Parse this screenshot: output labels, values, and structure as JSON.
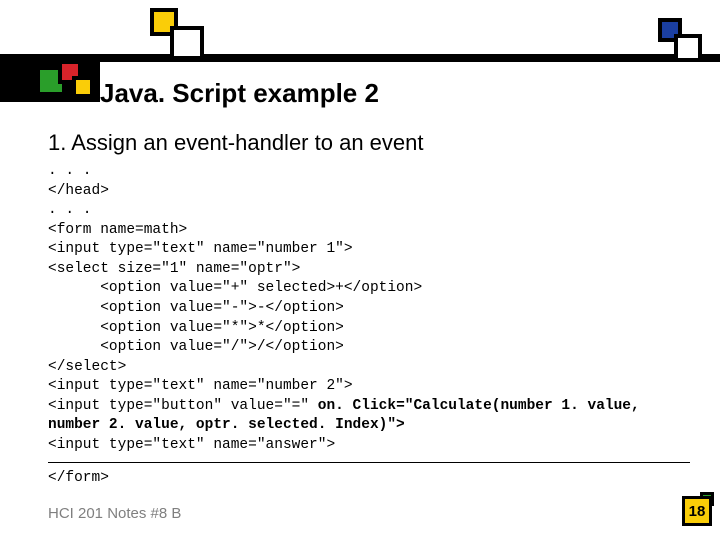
{
  "title": "Java. Script example 2",
  "subtitle": "1. Assign an event-handler to an event",
  "code": {
    "pre": ". . .\n</head>\n. . .\n<form name=math>\n<input type=\"text\" name=\"number 1\">\n<select size=\"1\" name=\"optr\">\n      <option value=\"+\" selected>+</option>\n      <option value=\"-\">-</option>\n      <option value=\"*\">*</option>\n      <option value=\"/\">/</option>\n</select>\n<input type=\"text\" name=\"number 2\">\n<input type=\"button\" value=\"=\" ",
    "bold": "on. Click=\"Calculate(number 1. value,\nnumber 2. value, optr. selected. Index)\">",
    "post": "\n<input type=\"text\" name=\"answer\">"
  },
  "after_code": "</form>",
  "footer": "HCI 201 Notes #8 B",
  "page_number": "18",
  "colors": {
    "yellow": "#facd08",
    "green": "#2a9e2a",
    "red": "#d8232a",
    "blue": "#1b3fa0"
  }
}
